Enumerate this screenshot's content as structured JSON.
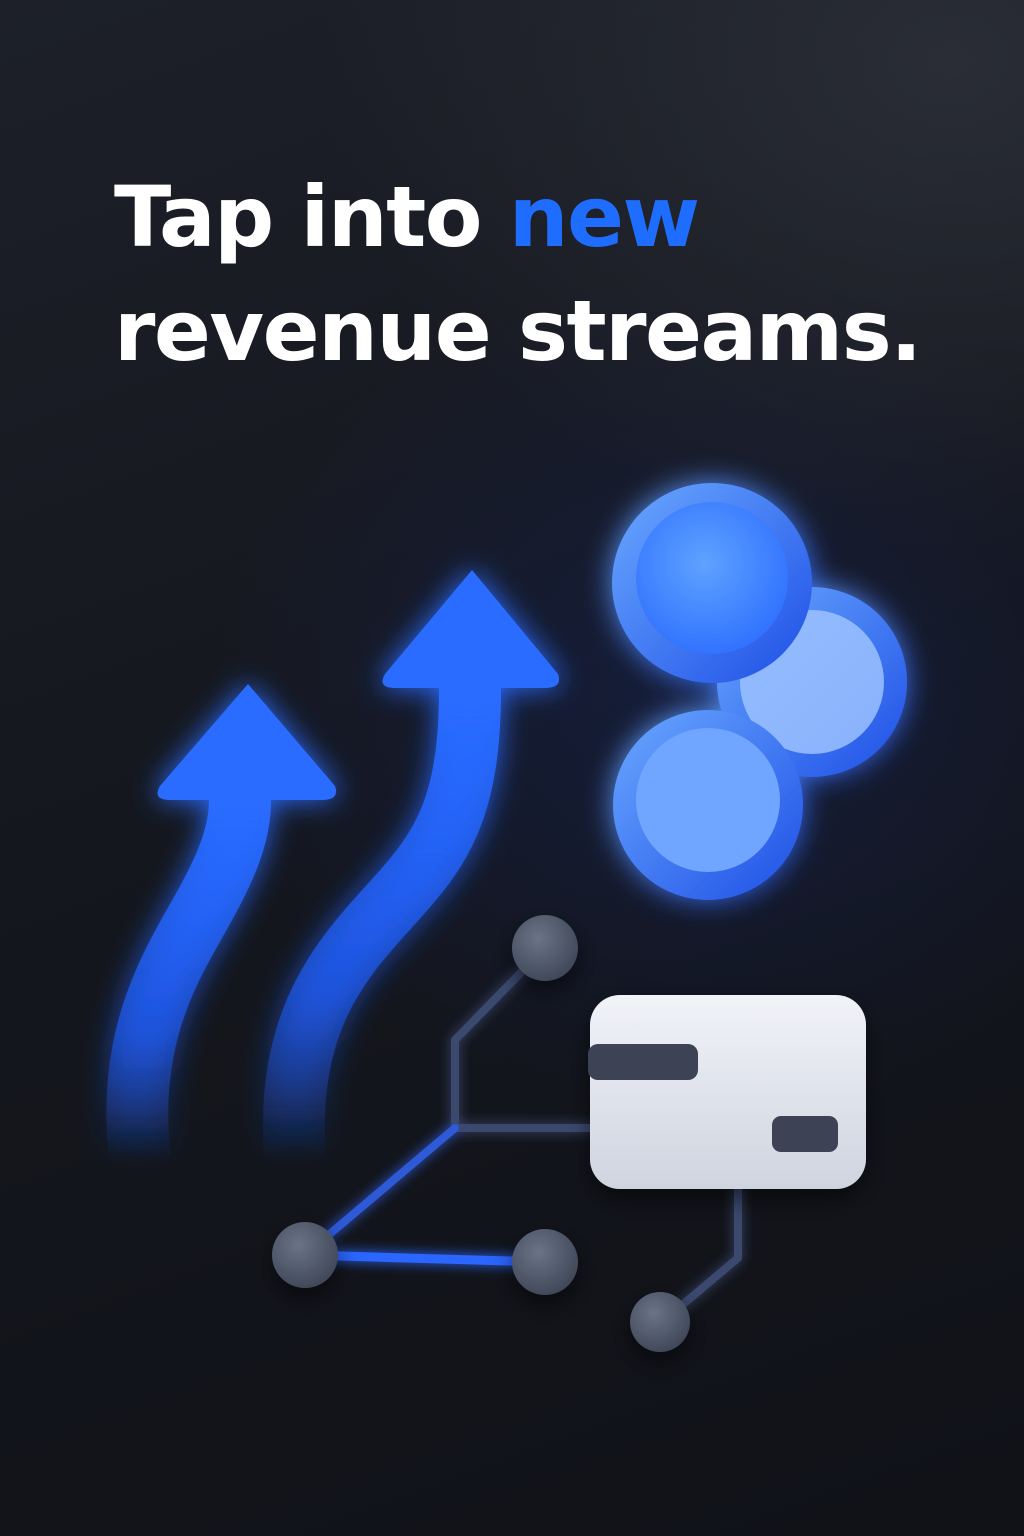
{
  "headline": {
    "line1_prefix": "Tap into ",
    "line1_accent": "new",
    "line2": "revenue streams."
  },
  "colors": {
    "background": "#15171e",
    "accent": "#1f6dff",
    "text": "#ffffff",
    "card": "#e6e9f1",
    "node": "#4a5468"
  },
  "illustration": {
    "icons": [
      "growth-arrow-icon",
      "coin-stack-icon",
      "network-node-icon",
      "card-icon"
    ]
  }
}
